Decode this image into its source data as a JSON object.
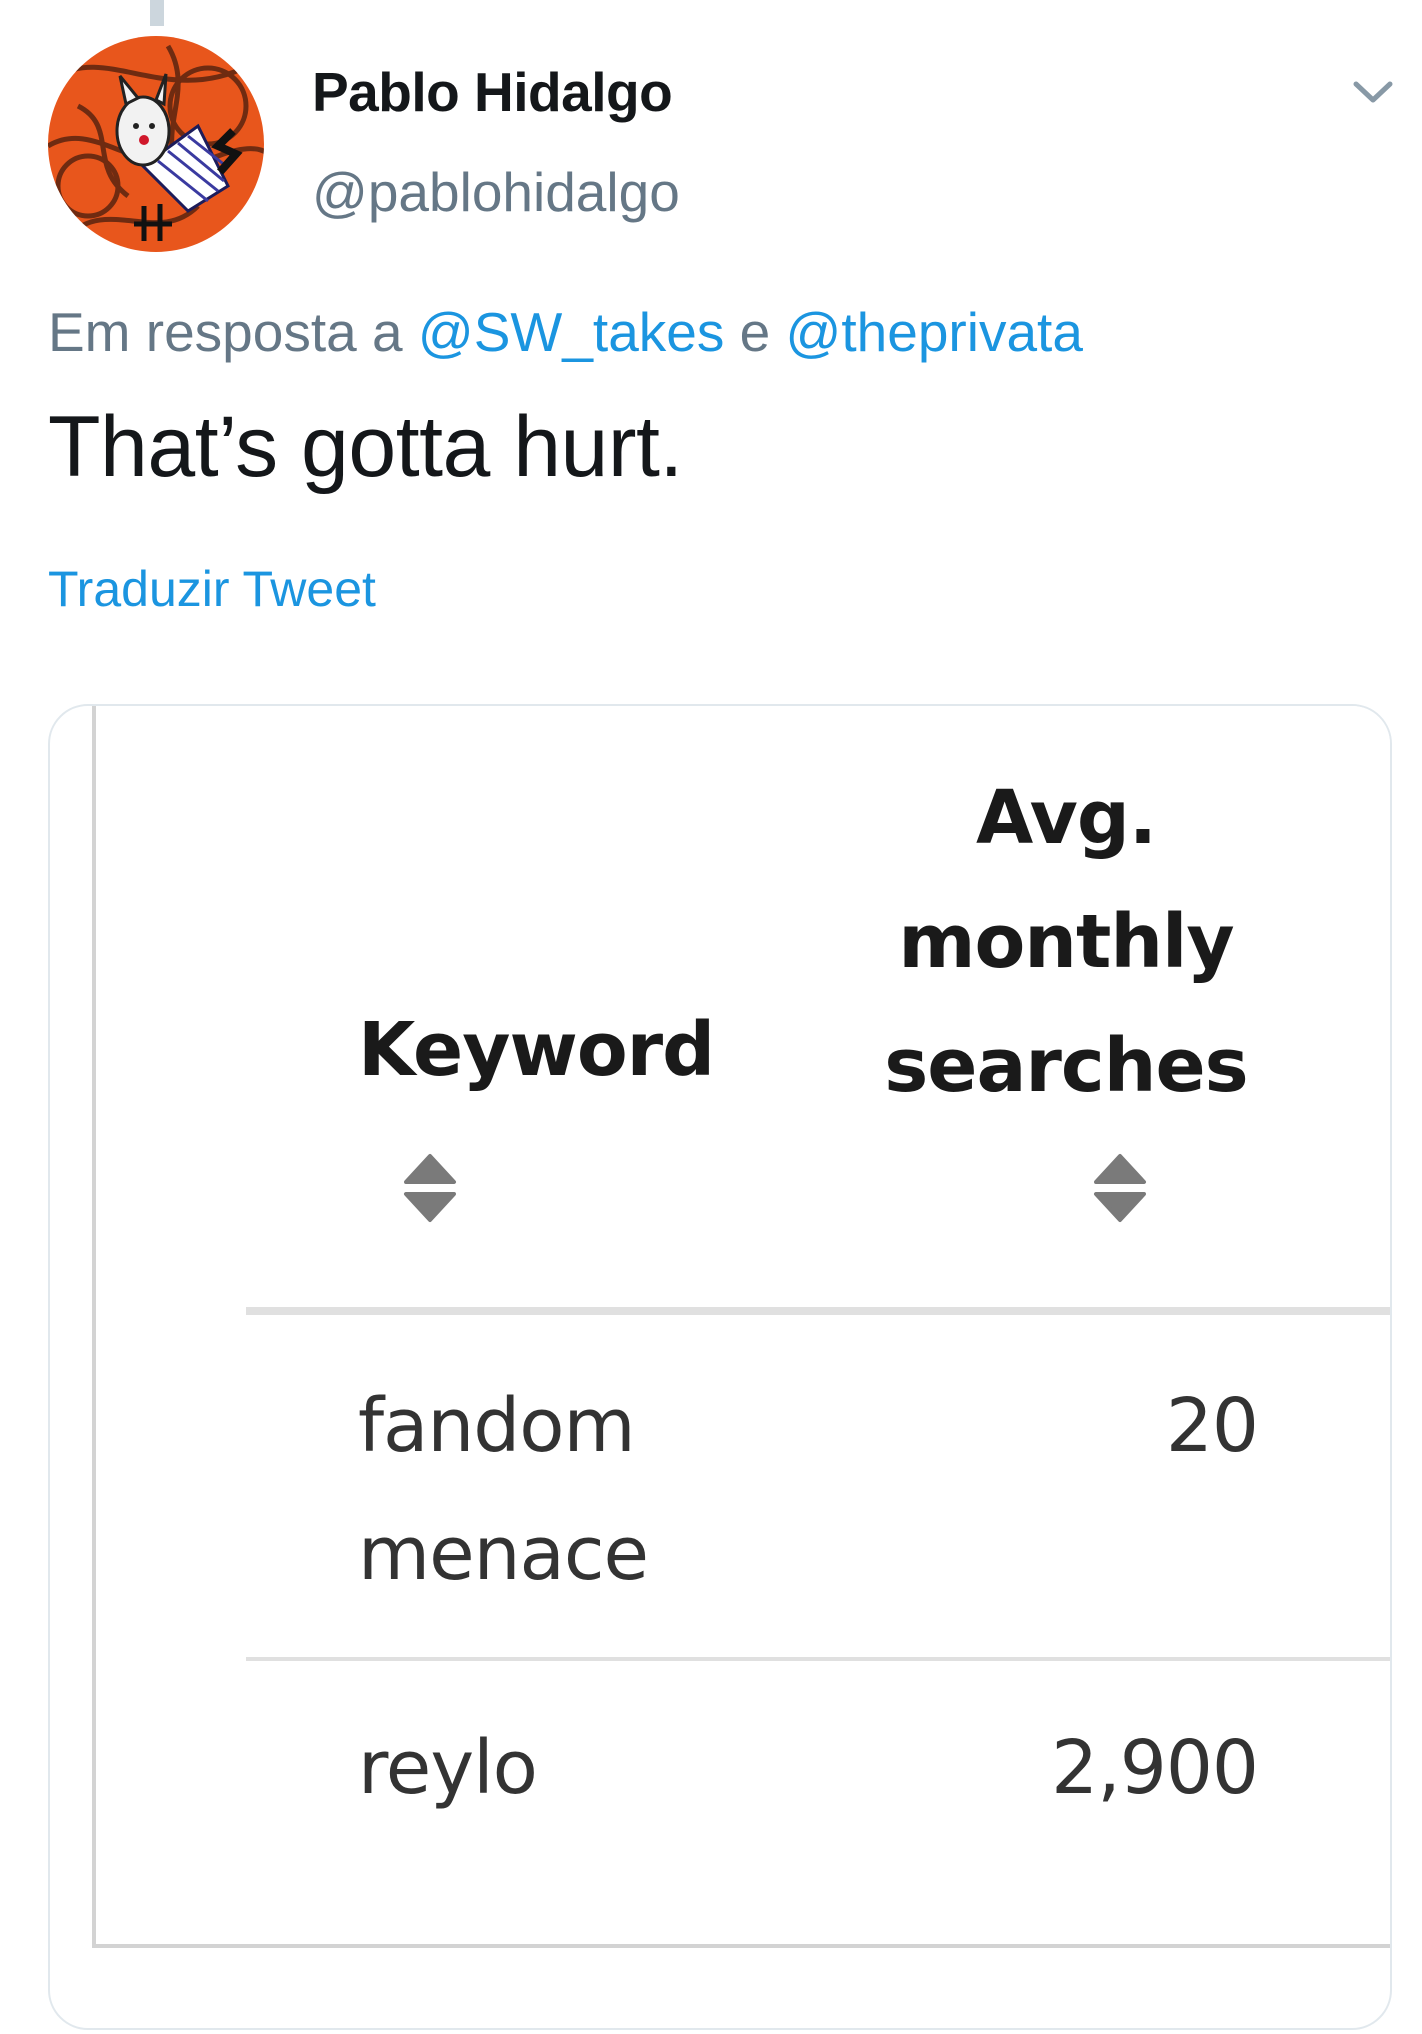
{
  "tweet": {
    "author_name": "Pablo Hidalgo",
    "author_handle": "@pablohidalgo",
    "reply_prefix": "Em resposta a",
    "reply_mention_1": "@SW_takes",
    "reply_joiner": "e",
    "reply_mention_2": "@theprivata",
    "text": "That’s gotta hurt.",
    "translate_label": "Traduzir Tweet",
    "menu_icon": "chevron-down-icon"
  },
  "media": {
    "table": {
      "columns": [
        {
          "label_lines": [
            "Keyword"
          ],
          "sort_icon": "sort-icon"
        },
        {
          "label_lines": [
            "Avg.",
            "monthly",
            "searches"
          ],
          "sort_icon": "sort-icon"
        }
      ],
      "rows": [
        {
          "keyword_lines": [
            "fandom",
            "menace"
          ],
          "searches": "20"
        },
        {
          "keyword_lines": [
            "reylo"
          ],
          "searches": "2,900"
        }
      ]
    }
  },
  "colors": {
    "text_primary": "#14171a",
    "text_secondary": "#657786",
    "link": "#1b95e0",
    "border": "#e1e8ed"
  }
}
